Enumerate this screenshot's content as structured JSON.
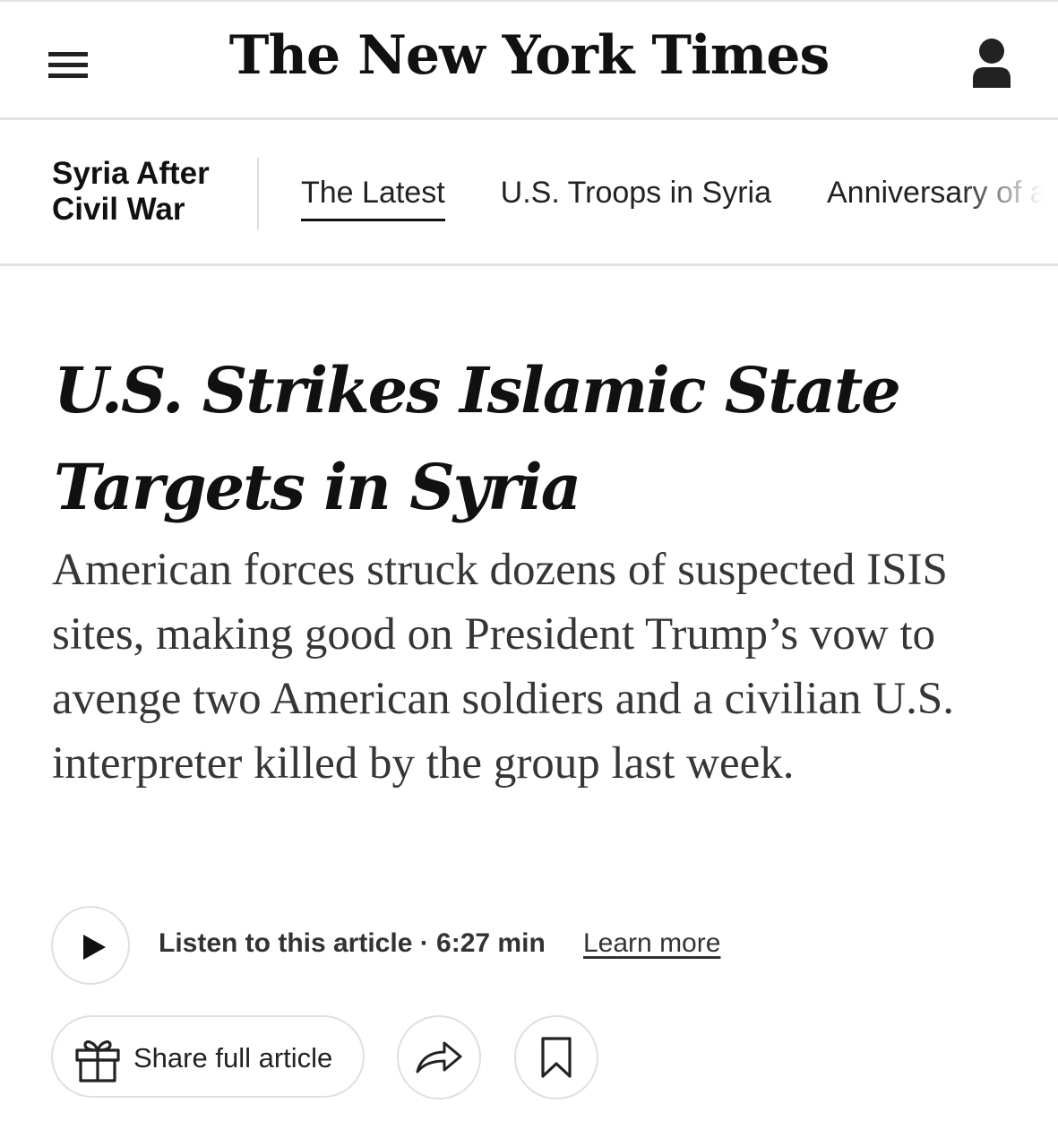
{
  "header": {
    "logo_text": "The New York Times",
    "menu_icon": "hamburger-menu-icon",
    "account_icon": "account-icon"
  },
  "section": {
    "title": "Syria After Civil War",
    "nav_items": [
      {
        "label": "The Latest",
        "active": true
      },
      {
        "label": "U.S. Troops in Syria",
        "active": false
      },
      {
        "label": "Anniversary of a",
        "active": false
      }
    ]
  },
  "article": {
    "headline": "U.S. Strikes Islamic State Targets in Syria",
    "summary": "American forces struck dozens of suspected ISIS sites, making good on President Trump’s vow to avenge two American soldiers and a civilian U.S. interpreter killed by the group last week."
  },
  "audio": {
    "play_icon": "play-icon",
    "listen_text": "Listen to this article · 6:27 min",
    "learn_more": "Learn more"
  },
  "actions": {
    "share_full_label": "Share full article",
    "gift_icon": "gift-icon",
    "share_icon": "share-arrow-icon",
    "save_icon": "bookmark-icon"
  }
}
